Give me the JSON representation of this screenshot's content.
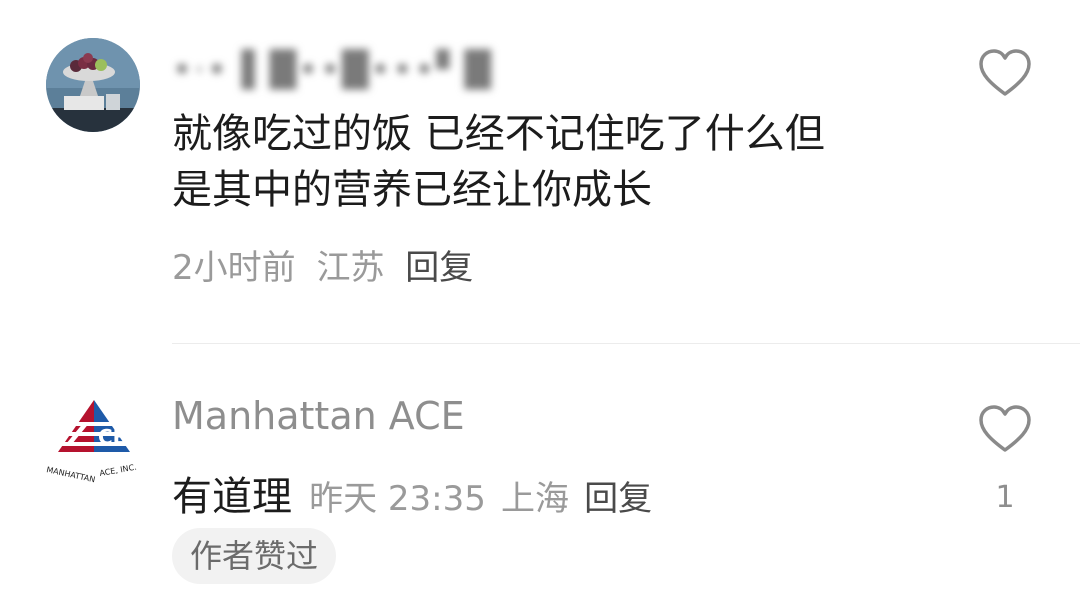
{
  "comments": [
    {
      "username": "•·• ▌█••█•••▘█",
      "lines": [
        "就像吃过的饭 已经不记住吃了什么但",
        "是其中的营养已经让你成长"
      ],
      "time": "2小时前",
      "location": "江苏",
      "reply_label": "回复",
      "like_count": ""
    },
    {
      "username": "Manhattan ACE",
      "text": "有道理",
      "time": "昨天 23:35",
      "location": "上海",
      "reply_label": "回复",
      "author_liked": "作者赞过",
      "like_count": "1",
      "avatar_logo_text": "MANHATTAN ACE, INC."
    }
  ],
  "colors": {
    "text_primary": "#1c1c1c",
    "text_secondary": "#9a9a9a",
    "heart_stroke": "#8a8a8a",
    "logo_red": "#b5122e",
    "logo_blue": "#1e5aa8"
  },
  "icons": {
    "like": "heart-outline-icon"
  }
}
